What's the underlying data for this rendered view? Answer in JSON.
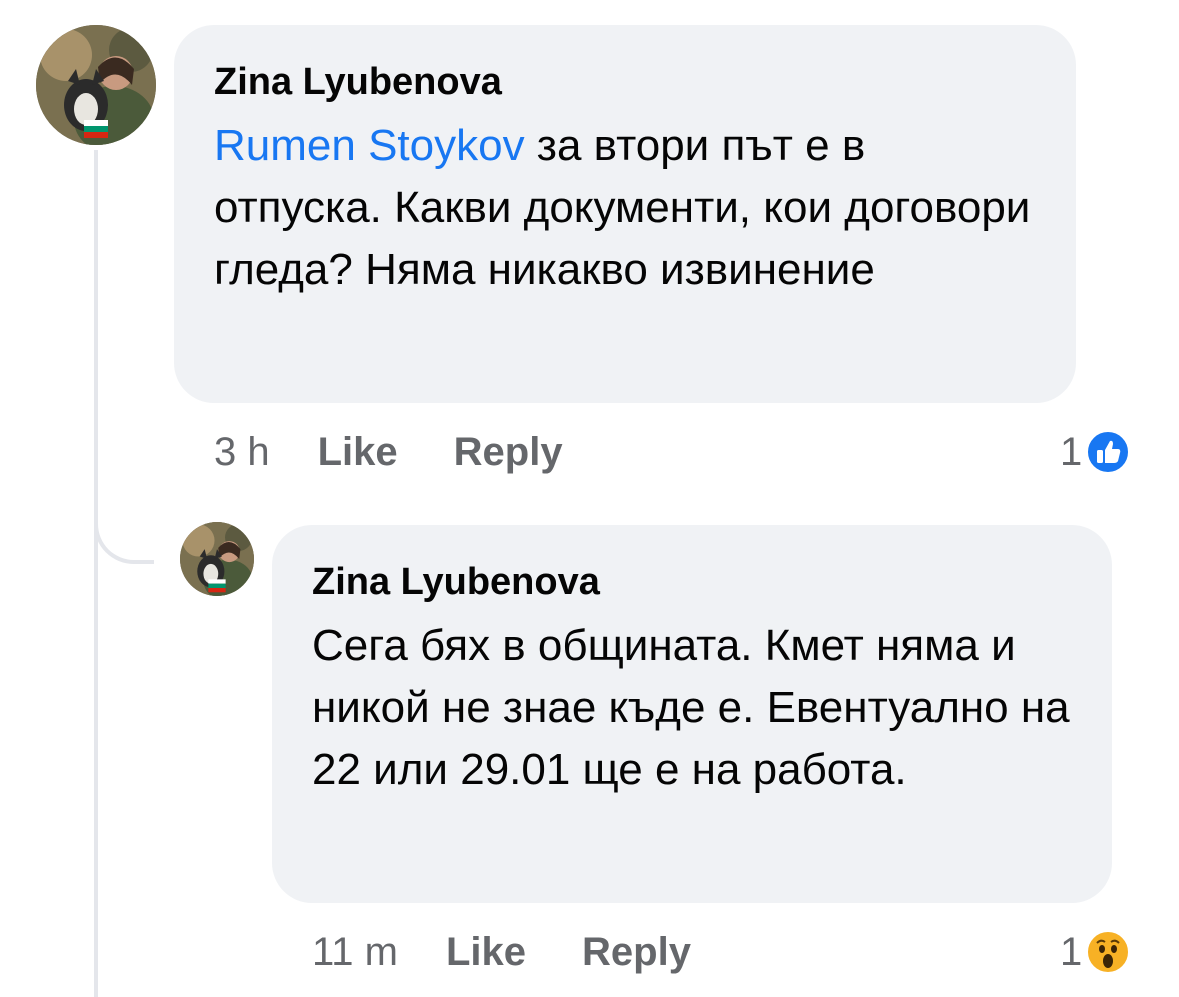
{
  "comments": [
    {
      "author": "Zina Lyubenova",
      "mention": "Rumen Stoykov",
      "text": " за втори път е в отпуска. Какви документи, кои договори гледа? Няма никакво извинение",
      "time": "3 h",
      "like_label": "Like",
      "reply_label": "Reply",
      "reaction_count": "1",
      "reaction_icon": "like-icon",
      "reaction_color": "#1877f2"
    },
    {
      "author": "Zina Lyubenova",
      "text": "Сега бях в общината. Кмет няма и никой не знае къде е. Евентуално на 22 или 29.01 ще е на работа.",
      "time": "11 m",
      "like_label": "Like",
      "reply_label": "Reply",
      "reaction_count": "1",
      "reaction_icon": "wow-icon",
      "reaction_color": "#f7b125"
    }
  ]
}
